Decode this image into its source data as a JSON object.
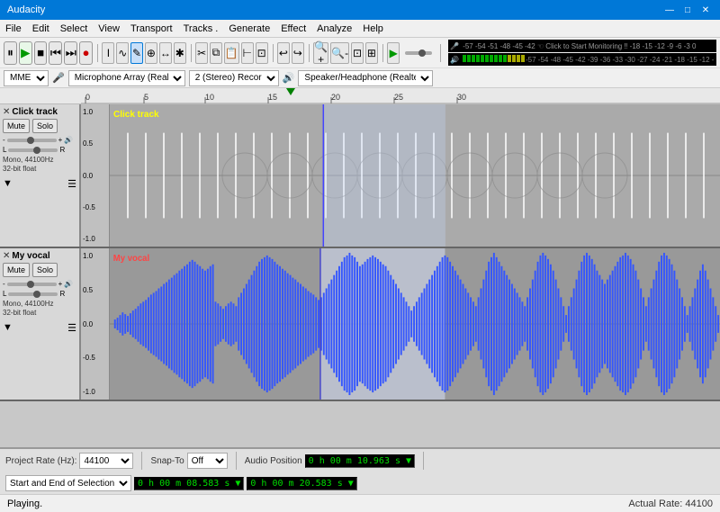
{
  "titlebar": {
    "title": "Audacity",
    "controls": [
      "—",
      "□",
      "✕"
    ]
  },
  "menubar": {
    "items": [
      "File",
      "Edit",
      "Select",
      "View",
      "Transport",
      "Tracks .",
      "Generate",
      "Effect",
      "Analyze",
      "Help"
    ]
  },
  "toolbar1": {
    "pause_label": "⏸",
    "play_label": "▶",
    "stop_label": "■",
    "skipstart_label": "⏮",
    "skipend_label": "⏭",
    "record_label": "●"
  },
  "toolbar2": {
    "tools": [
      "↗",
      "✱",
      "↔",
      "✱",
      "↕",
      "✱"
    ]
  },
  "device_row": {
    "host": "MME",
    "mic": "Microphone Array (Realtek",
    "channels": "2 (Stereo) Recor",
    "speaker": "Speaker/Headphone (Realte"
  },
  "ruler": {
    "marks": [
      "0",
      "5",
      "10",
      "15",
      "20",
      "25",
      "30"
    ]
  },
  "tracks": [
    {
      "name": "Click track",
      "close_btn": "✕",
      "mute": "Mute",
      "solo": "Solo",
      "gain_label": "",
      "pan_left": "L",
      "pan_right": "R",
      "info": "Mono, 44100Hz\n32-bit float",
      "label_color": "#ffff00",
      "type": "click"
    },
    {
      "name": "My vocal",
      "close_btn": "✕",
      "mute": "Mute",
      "solo": "Solo",
      "gain_label": "",
      "pan_left": "L",
      "pan_right": "R",
      "info": "Mono, 44100Hz\n32-bit float",
      "label_color": "#ff4444",
      "type": "vocal"
    }
  ],
  "bottom": {
    "project_rate_label": "Project Rate (Hz):",
    "project_rate": "44100",
    "snap_to_label": "Snap-To",
    "snap_to": "Off",
    "audio_pos_label": "Audio Position",
    "audio_pos": "0 h 00 m 10.963 s",
    "sel_label": "Start and End of Selection",
    "sel_start": "0 h 00 m 08.583 s",
    "sel_end": "0 h 00 m 20.583 s"
  },
  "statusbar": {
    "text": "Playing.",
    "rate": "Actual Rate: 44100"
  },
  "y_axis_click": [
    "1.0",
    "0.5",
    "0.0",
    "-0.5",
    "-1.0"
  ],
  "y_axis_vocal": [
    "1.0",
    "0.5",
    "0.0",
    "-0.5",
    "-1.0"
  ]
}
